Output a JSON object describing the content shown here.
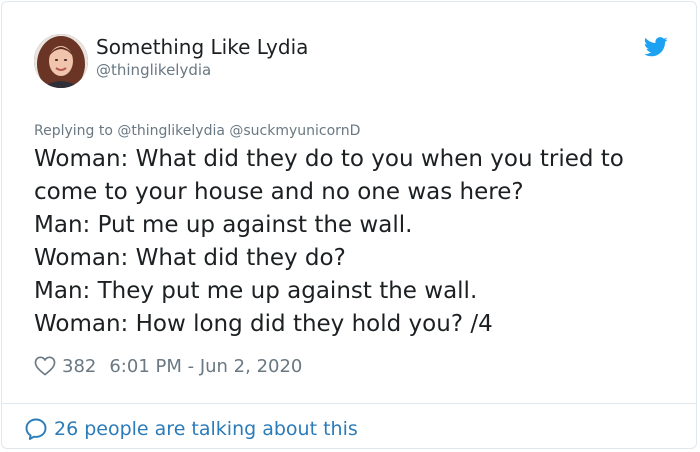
{
  "author": {
    "display_name": "Something Like Lydia",
    "handle": "@thinglikelydia",
    "avatar_icon": "profile-photo"
  },
  "reply": {
    "prefix": "Replying to",
    "mentions": [
      "@thinglikelydia",
      "@suckmyunicornD"
    ]
  },
  "tweet": {
    "lines": [
      "Woman: What did they do to you when you tried to",
      "come to your house and no one was here?",
      "Man: Put me up against the wall.",
      "Woman: What did they do?",
      "Man: They put me up against the wall.",
      "Woman: How long did they hold you? /4"
    ]
  },
  "meta": {
    "likes": "382",
    "timestamp": "6:01 PM - Jun 2, 2020"
  },
  "footer": {
    "talking_label": "26 people are talking about this"
  },
  "colors": {
    "brand_blue": "#1da1f2",
    "link_blue": "#2b7bb9",
    "muted_gray": "#697882",
    "text_dark": "#1c2022",
    "border": "#e1e8ed"
  }
}
